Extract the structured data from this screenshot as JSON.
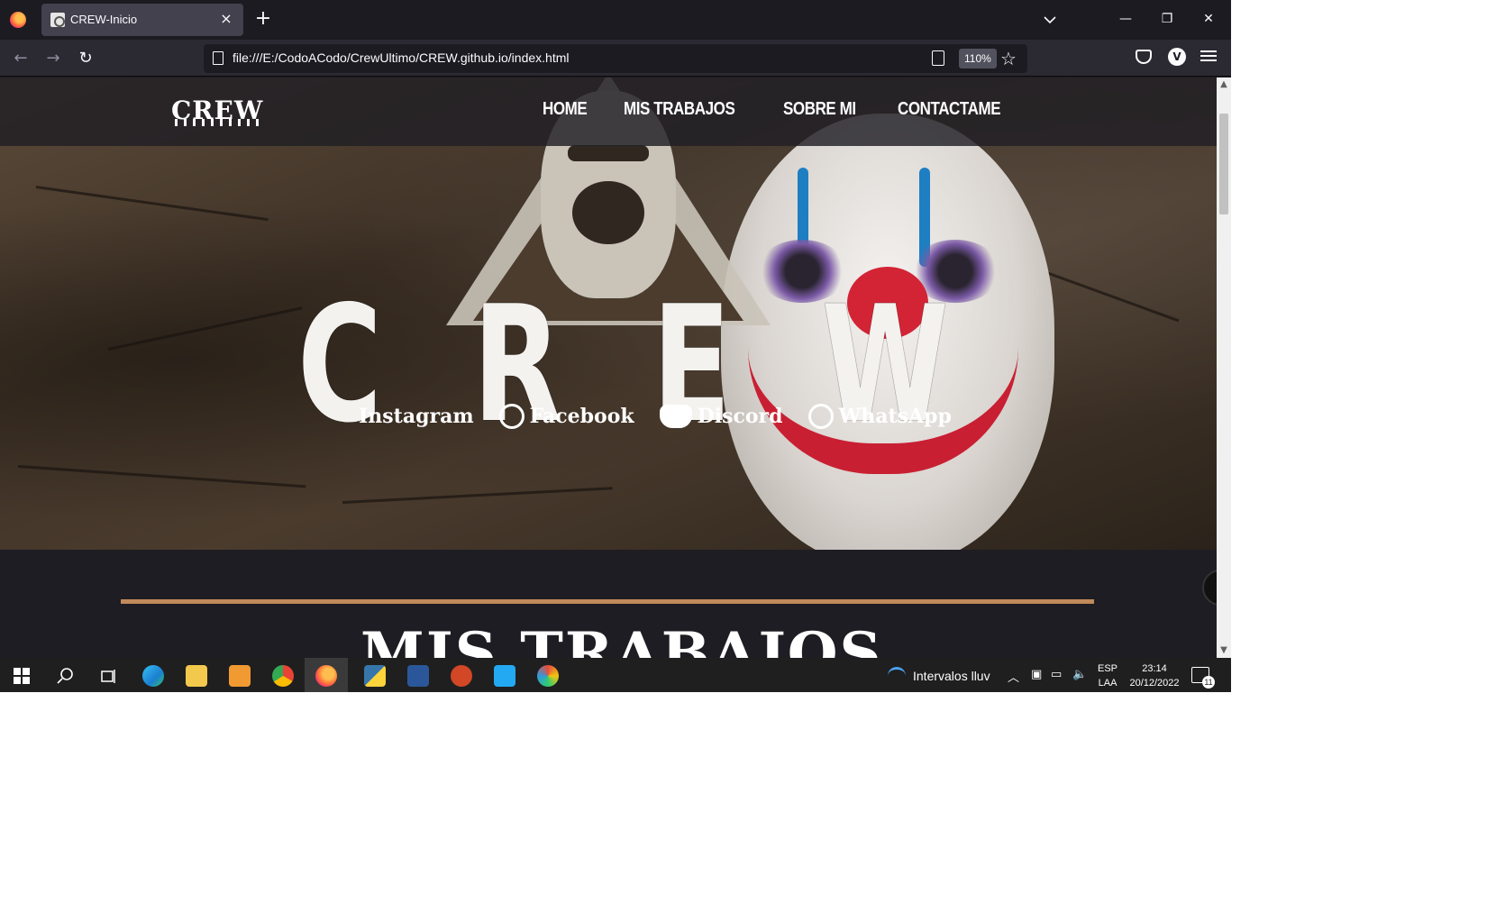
{
  "browser": {
    "tab_title": "CREW-Inicio",
    "tab_close": "×",
    "new_tab": "+",
    "url": "file:///E:/CodoACodo/CrewUltimo/CREW.github.io/index.html",
    "zoom": "110%",
    "account_initial": "V",
    "back_icon": "←",
    "forward_icon": "→",
    "reload_icon": "↻",
    "star_icon": "☆",
    "minimize_icon": "—",
    "restore_icon": "❐",
    "close_icon": "✕",
    "tab_list_icon": "⌄"
  },
  "site": {
    "logo": "CREW",
    "nav": [
      "HOME",
      "MIS TRABAJOS",
      "SOBRE MI",
      "CONTACTAME"
    ],
    "hero_letters": [
      "C",
      "R",
      "E",
      "W"
    ],
    "socials": [
      "Instagram",
      "Facebook",
      "Discord",
      "WhatsApp"
    ],
    "section_title": "MIS TRABAJOS",
    "divider_color": "#c18a5b"
  },
  "taskbar": {
    "weather": "Intervalos lluv",
    "lang_1": "ESP",
    "lang_2": "LAA",
    "time": "23:14",
    "date": "20/12/2022",
    "notifications": "11",
    "apps": [
      "edge-icon",
      "file-explorer-icon",
      "pdf-reader-icon",
      "chrome-icon",
      "firefox-icon",
      "python-icon",
      "word-icon",
      "powerpoint-icon",
      "vscode-icon",
      "paint-icon"
    ]
  }
}
